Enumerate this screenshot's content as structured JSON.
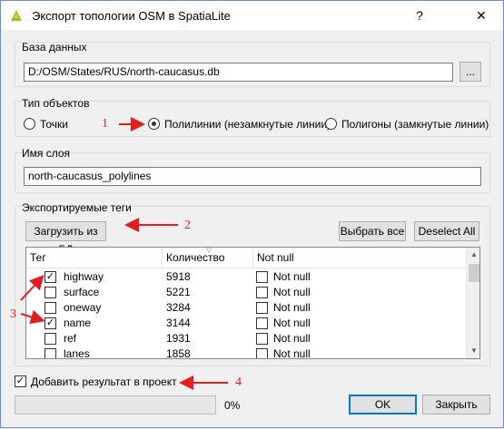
{
  "window": {
    "title": "Экспорт топологии OSM в SpatiaLite",
    "help_label": "?",
    "close_label": "✕"
  },
  "database": {
    "group_label": "База данных",
    "path_value": "D:/OSM/States/RUS/north-caucasus.db",
    "browse_label": "..."
  },
  "object_type": {
    "group_label": "Тип объектов",
    "options": [
      {
        "label": "Точки",
        "checked": false
      },
      {
        "label": "Полилинии (незамкнутые линии)",
        "checked": true
      },
      {
        "label": "Полигоны (замкнутые линии)",
        "checked": false
      }
    ]
  },
  "layer": {
    "group_label": "Имя слоя",
    "name_value": "north-caucasus_polylines"
  },
  "tags": {
    "group_label": "Экспортируемые теги",
    "load_label": "Загрузить из БД",
    "select_all_label": "Выбрать все",
    "deselect_all_label": "Deselect All",
    "columns": [
      "Тег",
      "Количество",
      "Not null"
    ],
    "rows": [
      {
        "tag": "highway",
        "count": "5918",
        "checked": true,
        "not_null": "Not null",
        "not_null_checked": false
      },
      {
        "tag": "surface",
        "count": "5221",
        "checked": false,
        "not_null": "Not null",
        "not_null_checked": false
      },
      {
        "tag": "oneway",
        "count": "3284",
        "checked": false,
        "not_null": "Not null",
        "not_null_checked": false
      },
      {
        "tag": "name",
        "count": "3144",
        "checked": true,
        "not_null": "Not null",
        "not_null_checked": false
      },
      {
        "tag": "ref",
        "count": "1931",
        "checked": false,
        "not_null": "Not null",
        "not_null_checked": false
      },
      {
        "tag": "lanes",
        "count": "1858",
        "checked": false,
        "not_null": "Not null",
        "not_null_checked": false
      }
    ]
  },
  "add_to_project": {
    "label": "Добавить результат в проект",
    "checked": true
  },
  "progress": {
    "value": 0,
    "label": "0%"
  },
  "buttons": {
    "ok_label": "OK",
    "close_label": "Закрыть"
  },
  "annotations": {
    "n1": "1",
    "n2": "2",
    "n3": "3",
    "n4": "4"
  },
  "colors": {
    "annotation": "#e02020",
    "accent": "#0078d7"
  }
}
